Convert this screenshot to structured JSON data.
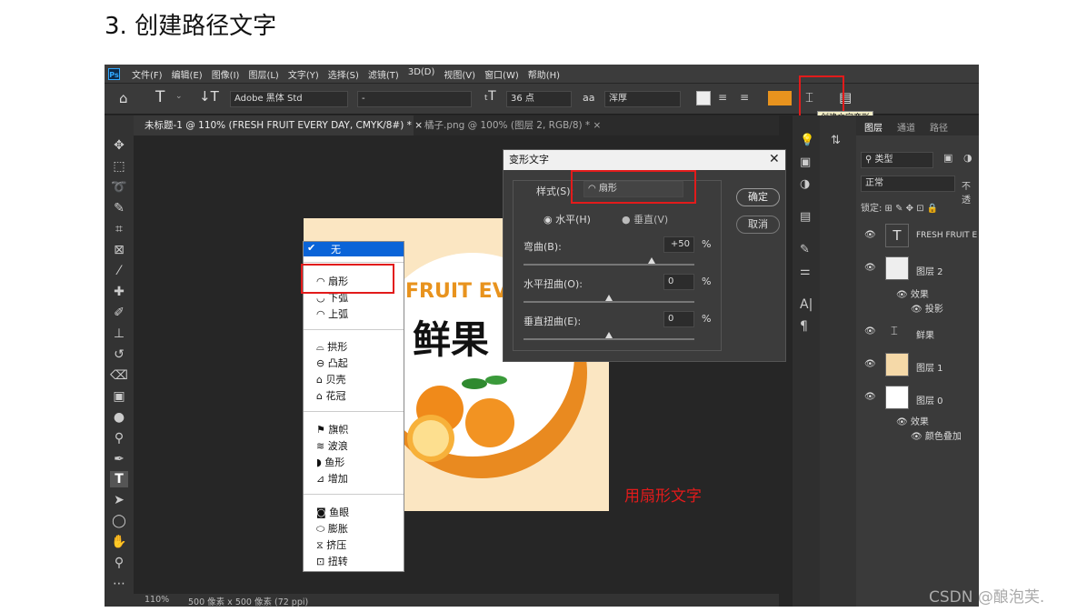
{
  "heading": "3.  创建路径文字",
  "menu": [
    "文件(F)",
    "编辑(E)",
    "图像(I)",
    "图层(L)",
    "文字(Y)",
    "选择(S)",
    "滤镜(T)",
    "3D(D)",
    "视图(V)",
    "窗口(W)",
    "帮助(H)"
  ],
  "options": {
    "font": "Adobe 黑体 Std",
    "style": "-",
    "size": "36 点",
    "aa_label": "aa",
    "aa": "浑厚",
    "color": "#e8931e",
    "tooltip": "创建文字变形"
  },
  "tabs": [
    "未标题-1 @ 110% (FRESH FRUIT EVERY DAY, CMYK/8#) *",
    "橘子.png @ 100% (图层 2, RGB/8) *"
  ],
  "dialog": {
    "title": "变形文字",
    "style_label": "样式(S):",
    "style_value": "扇形",
    "horizontal": "水平(H)",
    "vertical": "垂直(V)",
    "bend_label": "弯曲(B):",
    "bend_value": "+50",
    "hdist_label": "水平扭曲(O):",
    "hdist_value": "0",
    "vdist_label": "垂直扭曲(E):",
    "vdist_value": "0",
    "pct": "%",
    "ok": "确定",
    "cancel": "取消",
    "bend": 50,
    "hdist": 0,
    "vdist": 0
  },
  "dropdown": {
    "none": "无",
    "g1": [
      "扇形",
      "下弧",
      "上弧"
    ],
    "g2": [
      "拱形",
      "凸起",
      "贝壳",
      "花冠"
    ],
    "g3": [
      "旗帜",
      "波浪",
      "鱼形",
      "增加"
    ],
    "g4": [
      "鱼眼",
      "膨胀",
      "挤压",
      "扭转"
    ]
  },
  "canvas": {
    "fruit_text": "FRUIT EVE",
    "chinese": "鲜果",
    "note": "用扇形文字"
  },
  "layers_panel": {
    "tabs": [
      "图层",
      "通道",
      "路径"
    ],
    "filter": "类型",
    "blend": "正常",
    "opacity": "不透",
    "lock": "锁定:"
  },
  "layers": [
    {
      "name": "FRESH FRUIT E"
    },
    {
      "name": "图层 2",
      "effects": "效果",
      "fx": "投影"
    },
    {
      "name": "鲜果"
    },
    {
      "name": "图层 1"
    },
    {
      "name": "图层 0",
      "effects": "效果",
      "fx": "颜色叠加"
    }
  ],
  "status": {
    "zoom": "110%",
    "size": "500 像素 x 500 像素 (72 ppi)"
  },
  "watermark": "CSDN @酿泡芙."
}
